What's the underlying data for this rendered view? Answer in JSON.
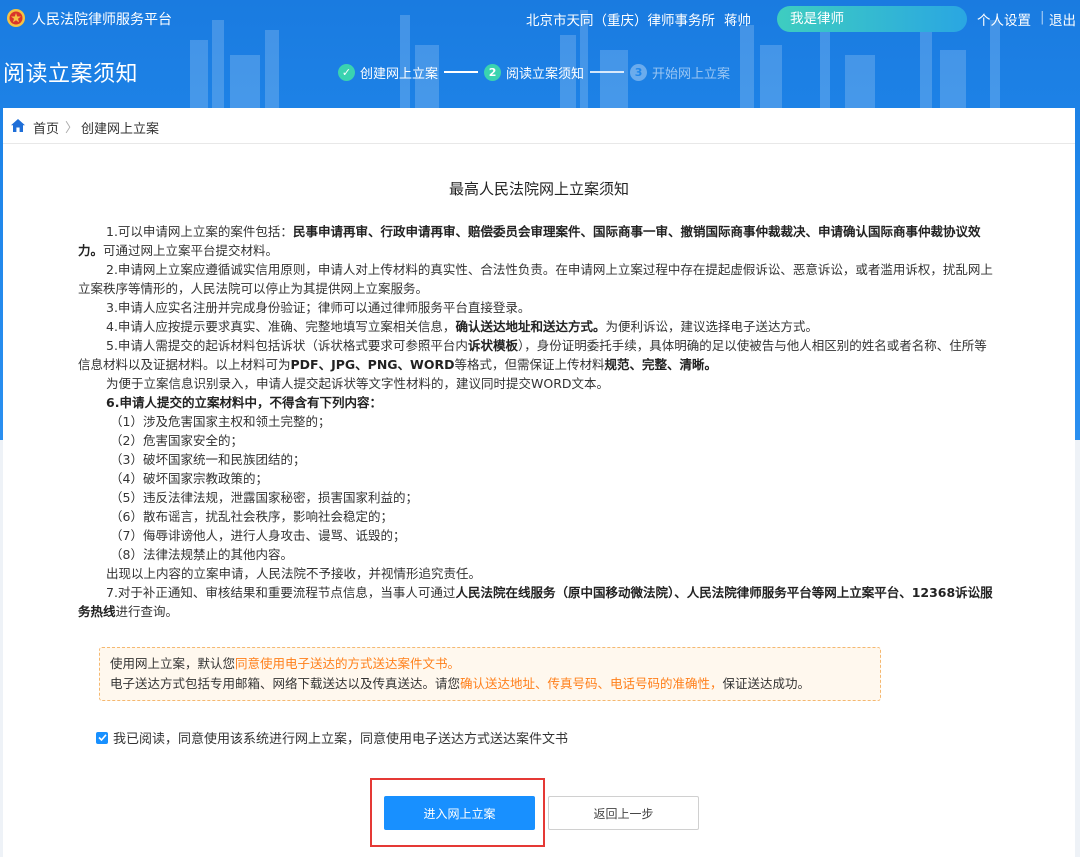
{
  "colors": {
    "primary": "#1890ff",
    "header_blue": "#1f86ea",
    "highlight": "#ff7f1a",
    "frame_red": "#e53935",
    "step_green": "#3ad3b0"
  },
  "header": {
    "logo_icon": "court-emblem-icon",
    "app_title": "人民法院律师服务平台",
    "firm": "北京市天同（重庆）律师事务所",
    "user": "蒋帅",
    "role": "我是律师",
    "personal_settings": "个人设置",
    "divider": "|",
    "logout": "退出"
  },
  "page_title": "阅读立案须知",
  "steps": [
    {
      "num": "1",
      "label": "创建网上立案",
      "state": "done"
    },
    {
      "num": "2",
      "label": "阅读立案须知",
      "state": "active"
    },
    {
      "num": "3",
      "label": "开始网上立案",
      "state": "todo"
    }
  ],
  "breadcrumb": {
    "home": "首页",
    "sep": "〉",
    "current": "创建网上立案"
  },
  "notice": {
    "title": "最高人民法院网上立案须知",
    "p1_a": "1.可以申请网上立案的案件包括：",
    "p1_b": "民事申请再审、行政申请再审、赔偿委员会审理案件、国际商事一审、撤销国际商事仲裁裁决、申请确认国际商事仲裁协议效力。",
    "p1_c": "可通过网上立案平台提交材料。",
    "p2": "2.申请网上立案应遵循诚实信用原则，申请人对上传材料的真实性、合法性负责。在申请网上立案过程中存在提起虚假诉讼、恶意诉讼，或者滥用诉权，扰乱网上立案秩序等情形的，人民法院可以停止为其提供网上立案服务。",
    "p3": "3.申请人应实名注册并完成身份验证；律师可以通过律师服务平台直接登录。",
    "p4_a": "4.申请人应按提示要求真实、准确、完整地填写立案相关信息，",
    "p4_b": "确认送达地址和送达方式。",
    "p4_c": "为便利诉讼，建议选择电子送达方式。",
    "p5_a": "5.申请人需提交的起诉材料包括诉状（诉状格式要求可参照平台内",
    "p5_b": "诉状模板",
    "p5_c": "），身份证明委托手续，具体明确的足以使被告与他人相区别的姓名或者名称、住所等信息材料以及证据材料。以上材料可为",
    "p5_d": "PDF、JPG、PNG、WORD",
    "p5_e": "等格式，但需保证上传材料",
    "p5_f": "规范、完整、清晰。",
    "p5_note": "为便于立案信息识别录入，申请人提交起诉状等文字性材料的，建议同时提交WORD文本。",
    "p6": "6.申请人提交的立案材料中，不得含有下列内容：",
    "items": [
      "（1）涉及危害国家主权和领土完整的；",
      "（2）危害国家安全的；",
      "（3）破坏国家统一和民族团结的；",
      "（4）破坏国家宗教政策的；",
      "（5）违反法律法规，泄露国家秘密，损害国家利益的；",
      "（6）散布谣言，扰乱社会秩序，影响社会稳定的；",
      "（7）侮辱诽谤他人，进行人身攻击、谩骂、诋毁的；",
      "（8）法律法规禁止的其他内容。"
    ],
    "p6_note": "出现以上内容的立案申请，人民法院不予接收，并视情形追究责任。",
    "p7_a": "7.对于补正通知、审核结果和重要流程节点信息，当事人可通过",
    "p7_b": "人民法院在线服务（原中国移动微法院）、人民法院律师服务平台等网上立案平台、12368诉讼服务热线",
    "p7_c": "进行查询。"
  },
  "tip": {
    "l1_a": "使用网上立案，默认您",
    "l1_b": "同意使用电子送达的方式送达案件文书。",
    "l2_a": "电子送达方式包括专用邮箱、网络下载送达以及传真送达。请您",
    "l2_b": "确认送达地址、传真号码、电话号码的准确性，",
    "l2_c": "保证送达成功。"
  },
  "agree_label": "我已阅读，同意使用该系统进行网上立案，同意使用电子送达方式送达案件文书",
  "buttons": {
    "enter": "进入网上立案",
    "back": "返回上一步"
  }
}
